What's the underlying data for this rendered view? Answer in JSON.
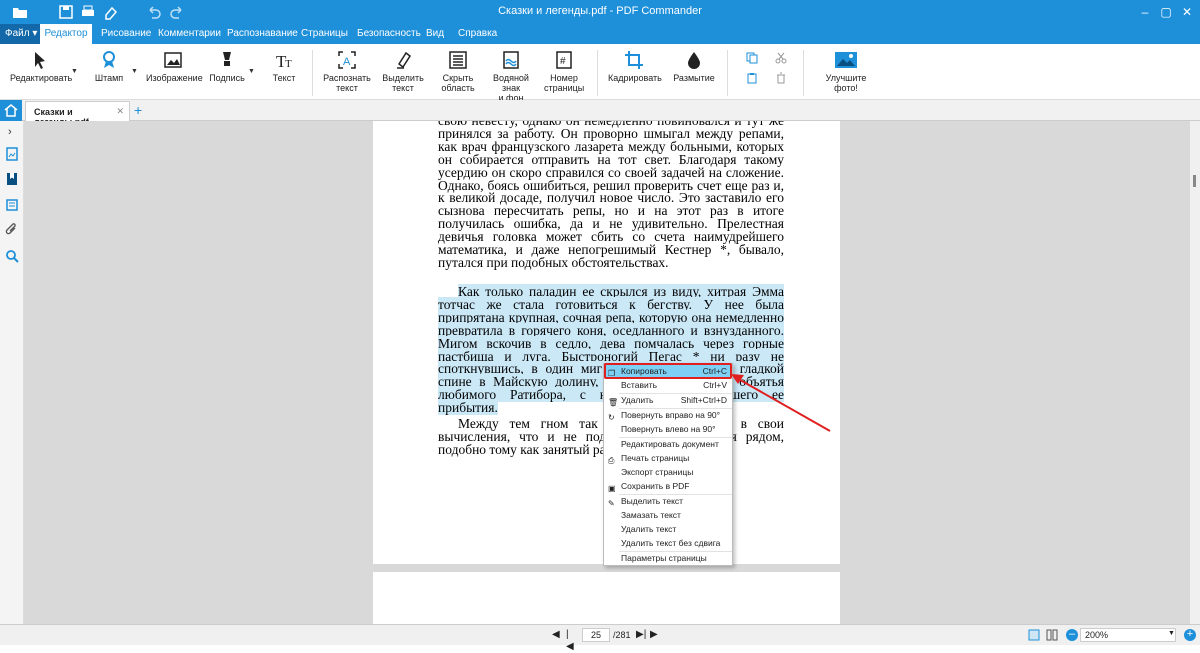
{
  "window": {
    "title": "Сказки и легенды.pdf - PDF Commander"
  },
  "menubar": {
    "file": "Файл",
    "tabs": [
      "Редактор",
      "Рисование",
      "Комментарии",
      "Распознавание",
      "Страницы",
      "Безопасность",
      "Вид",
      "Справка"
    ]
  },
  "ribbon": {
    "edit": "Редактировать",
    "stamp": "Штамп",
    "image": "Изображение",
    "signature": "Подпись",
    "text": "Текст",
    "recognize_1": "Распознать",
    "recognize_2": "текст",
    "select_1": "Выделить",
    "select_2": "текст",
    "hide_1": "Скрыть",
    "hide_2": "область",
    "watermark_1": "Водяной знак",
    "watermark_2": "и фон",
    "pagenum_1": "Номер",
    "pagenum_2": "страницы",
    "crop": "Кадрировать",
    "blur": "Размытие",
    "enhance": "Улучшите фото!"
  },
  "tabs": {
    "document": "Сказки и легенды.pdf",
    "close": "✕",
    "add": "+"
  },
  "page": {
    "p1": "свою невесту, однако он немедленно повиновался и тут же принялся за работу. Он проворно шмыгал между репами, как врач французского лазарета между больными, которых он собирается отправить на тот свет. Благодаря такому усердию он скоро справился со своей задачей на сложение. Однако, боясь ошибиться, решил проверить счет еще раз и, к великой досаде, получил новое число. Это заставило его сызнова пересчитать репы, но и на этот раз в итоге получилась ошибка, да и не удивительно. Прелестная девичья головка может сбить со счета наимудрейшего математика, и даже непогрешимый Кестнер *, бывало, путался при подобных обстоятельствах.",
    "p2": "Как только паладин ее скрылся из виду, хитрая Эмма тотчас же стала готовиться к бегству. У нее была припрятана крупная, сочная репа, которую она немедленно превратила в горячего коня, оседланного и взнузданного. Мигом вскочив в седло, дева помчалась через горные пастбища и луга. Быстроногий Пегас * ни разу не споткнувшись, в один миг домчал ее на своей гладкой спине в Майскую долину, где она бросилась в объятья любимого Ратибора, с нетерпением ожидавшего ее прибытия.",
    "p3": "Между тем гном так усердно погрузился в свои вычисления, что и не подозревал ничего, сидя рядом, подобно тому как занятый расчетами Ньютон * не"
  },
  "context_menu": {
    "copy": "Копировать",
    "copy_sc": "Ctrl+C",
    "paste": "Вставить",
    "paste_sc": "Ctrl+V",
    "delete": "Удалить",
    "delete_sc": "Shift+Ctrl+D",
    "rotate_right": "Повернуть вправо на 90°",
    "rotate_left": "Повернуть влево на 90°",
    "edit_doc": "Редактировать документ",
    "print_pages": "Печать страницы",
    "export_page": "Экспорт страницы",
    "save_pdf": "Сохранить в PDF",
    "select_text": "Выделить текст",
    "blur_text": "Замазать текст",
    "delete_text": "Удалить текст",
    "delete_text_noshift": "Удалить текст без сдвига",
    "page_params": "Параметры страницы"
  },
  "status": {
    "page": "25",
    "total": "/281",
    "zoom": "200%",
    "zoom_level_percent": 200
  },
  "colors": {
    "accent": "#1e8fd9",
    "highlight": "#cbe8f7",
    "annotation": "#e02020",
    "menu_hover": "#7fd0f5"
  }
}
